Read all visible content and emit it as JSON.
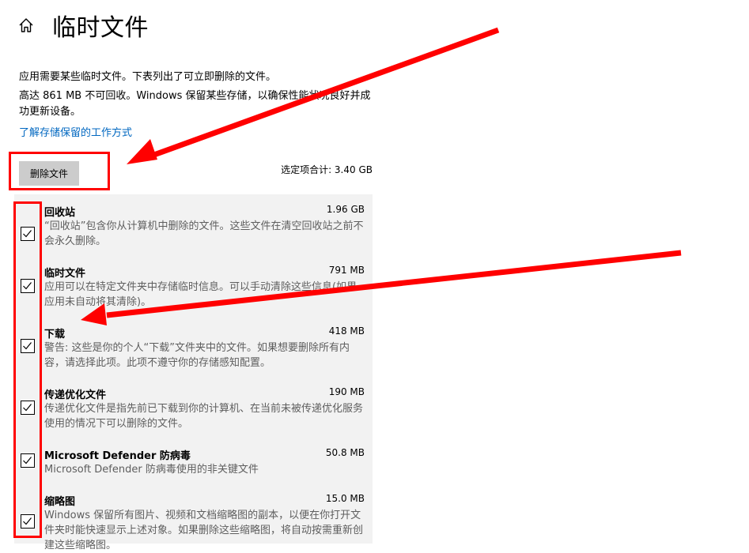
{
  "page": {
    "title": "临时文件",
    "description_1": "应用需要某些临时文件。下表列出了可立即删除的文件。",
    "description_2": "高达 861 MB 不可回收。Windows 保留某些存储，以确保性能状况良好并成功更新设备。",
    "learn_link": "了解存储保留的工作方式",
    "delete_button": "删除文件",
    "total_selected": "选定项合计: 3.40 GB"
  },
  "items": [
    {
      "name": "回收站",
      "size": "1.96 GB",
      "checked": true,
      "description": "“回收站”包含你从计算机中删除的文件。这些文件在清空回收站之前不会永久删除。"
    },
    {
      "name": "临时文件",
      "size": "791 MB",
      "checked": true,
      "description": "应用可以在特定文件夹中存储临时信息。可以手动清除这些信息(如果应用未自动将其清除)。"
    },
    {
      "name": "下载",
      "size": "418 MB",
      "checked": true,
      "description": "警告: 这些是你的个人“下载”文件夹中的文件。如果想要删除所有内容，请选择此项。此项不遵守你的存储感知配置。"
    },
    {
      "name": "传递优化文件",
      "size": "190 MB",
      "checked": true,
      "description": "传递优化文件是指先前已下载到你的计算机、在当前未被传递优化服务使用的情况下可以删除的文件。"
    },
    {
      "name": "Microsoft Defender 防病毒",
      "size": "50.8 MB",
      "checked": true,
      "description": "Microsoft Defender 防病毒使用的非关键文件"
    },
    {
      "name": "缩略图",
      "size": "15.0 MB",
      "checked": true,
      "description": "Windows 保留所有图片、视频和文档缩略图的副本，以便在你打开文件夹时能快速显示上述对象。如果删除这些缩略图，将自动按需重新创建这些缩略图。"
    }
  ],
  "colors": {
    "link": "#0067c0",
    "annotation": "#ff0000",
    "panel": "#f2f2f2",
    "button": "#cccccc"
  }
}
